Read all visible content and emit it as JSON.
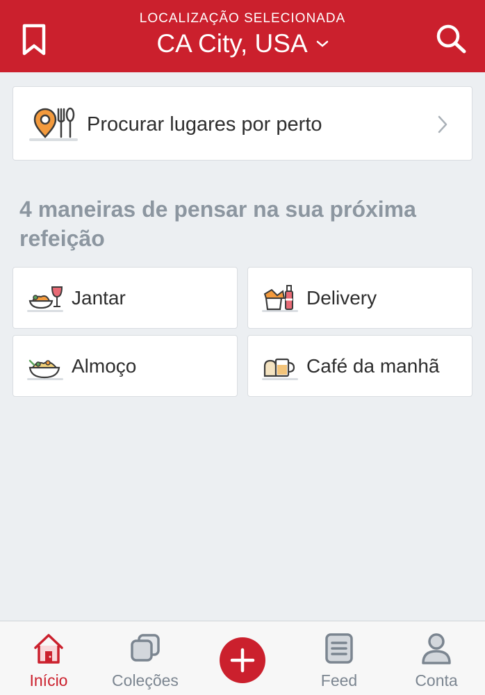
{
  "header": {
    "caption": "LOCALIZAÇÃO SELECIONADA",
    "city": "CA City, USA",
    "icons": {
      "left": "bookmark-icon",
      "right": "search-icon",
      "city_toggle": "chevron-down-icon"
    },
    "background": "#cb202d"
  },
  "nearby": {
    "label": "Procurar lugares por perto",
    "icon": "location-fork-spoon-icon",
    "arrow": "chevron-right-icon"
  },
  "section_title": "4 maneiras de pensar na sua próxima refeição",
  "categories": [
    {
      "label": "Jantar",
      "icon": "dinner-icon"
    },
    {
      "label": "Delivery",
      "icon": "delivery-icon"
    },
    {
      "label": "Almoço",
      "icon": "lunch-icon"
    },
    {
      "label": "Café da manhã",
      "icon": "breakfast-icon"
    }
  ],
  "tabbar": {
    "items": [
      {
        "label": "Início",
        "icon": "home-icon",
        "active": true
      },
      {
        "label": "Coleções",
        "icon": "collections-icon",
        "active": false
      },
      {
        "label": "",
        "icon": "plus-icon",
        "active": false
      },
      {
        "label": "Feed",
        "icon": "feed-icon",
        "active": false
      },
      {
        "label": "Conta",
        "icon": "account-icon",
        "active": false
      }
    ]
  },
  "colors": {
    "accent": "#cb202d",
    "background": "#eceff2",
    "muted_text": "#8c96a0",
    "tab_inactive": "#7b8590"
  }
}
